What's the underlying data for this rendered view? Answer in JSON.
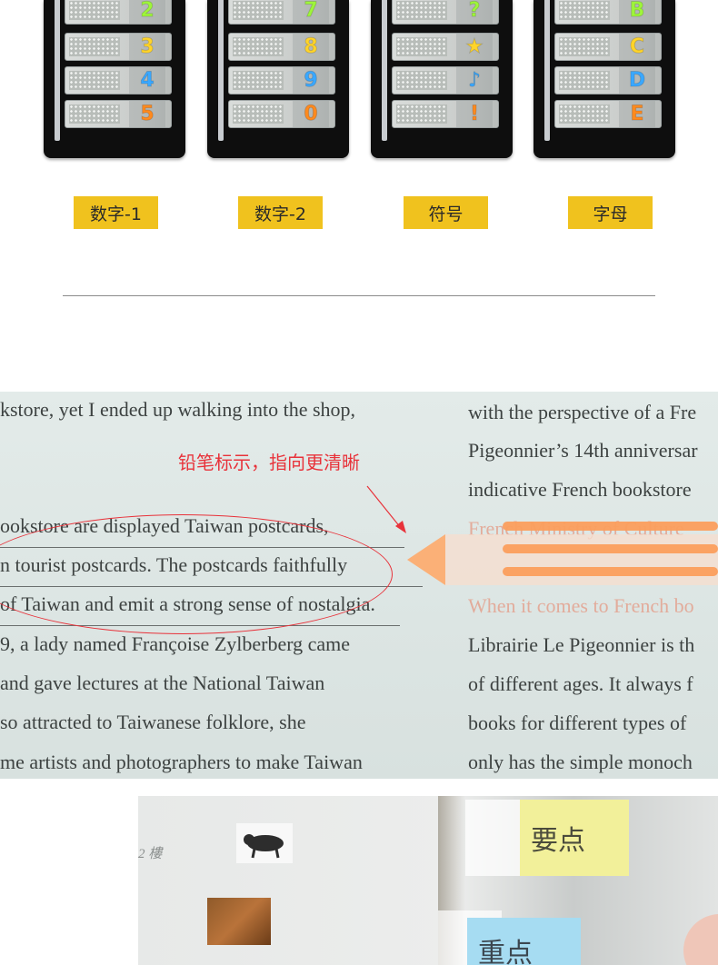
{
  "products": [
    {
      "label": "数字-1",
      "glyphs": [
        "2",
        "3",
        "4",
        "5"
      ],
      "colors": [
        "#9ef53a",
        "#ffd42a",
        "#3aa8ff",
        "#ff8a1e"
      ]
    },
    {
      "label": "数字-2",
      "glyphs": [
        "7",
        "8",
        "9",
        "0"
      ],
      "colors": [
        "#9ef53a",
        "#ffd42a",
        "#3aa8ff",
        "#ff8a1e"
      ]
    },
    {
      "label": "符号",
      "glyphs": [
        "?",
        "★",
        "♪",
        "!"
      ],
      "colors": [
        "#9ef53a",
        "#ffd42a",
        "#3aa8ff",
        "#ff8a1e"
      ]
    },
    {
      "label": "字母",
      "glyphs": [
        "B",
        "C",
        "D",
        "E"
      ],
      "colors": [
        "#9ef53a",
        "#ffd42a",
        "#3aa8ff",
        "#ff8a1e"
      ]
    }
  ],
  "book": {
    "annotation": "铅笔标示，指向更清晰",
    "left_lines": [
      "kstore, yet I ended up walking into the shop,",
      "ookstore are displayed Taiwan postcards,",
      "n tourist postcards. The postcards faithfully",
      "of Taiwan and emit a strong sense of nostalgia.",
      "9, a lady named Françoise Zylberberg came",
      "and gave lectures at the National Taiwan",
      " so attracted to Taiwanese folklore, she",
      "me artists and photographers to make Taiwan"
    ],
    "right_lines": [
      "with the perspective of a Fre",
      "Pigeonnier’s 14th anniversar",
      "indicative French bookstore",
      "French Ministry of Culture",
      "When it comes to French bo",
      "Librairie Le Pigeonnier is th",
      "of different ages. It always f",
      "books for different types of",
      "only has the simple monoch"
    ]
  },
  "notes": {
    "page_label": "2 樓",
    "note1": "要点",
    "note2": "重点"
  }
}
